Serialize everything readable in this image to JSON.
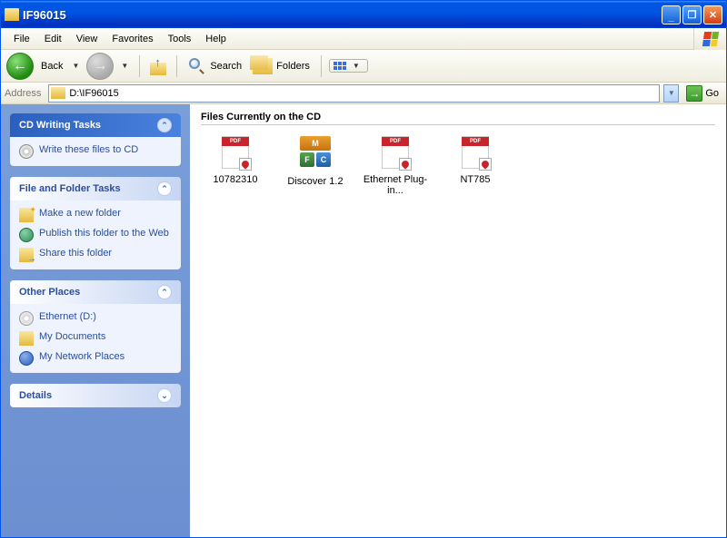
{
  "titlebar": {
    "title": "IF96015"
  },
  "menubar": {
    "items": [
      "File",
      "Edit",
      "View",
      "Favorites",
      "Tools",
      "Help"
    ]
  },
  "toolbar": {
    "back": "Back",
    "search": "Search",
    "folders": "Folders"
  },
  "addressbar": {
    "label": "Address",
    "path": "D:\\IF96015",
    "go": "Go"
  },
  "sidebar": {
    "cd_tasks": {
      "title": "CD Writing Tasks",
      "items": [
        "Write these files to CD"
      ]
    },
    "file_tasks": {
      "title": "File and Folder Tasks",
      "items": [
        "Make a new folder",
        "Publish this folder to the Web",
        "Share this folder"
      ]
    },
    "other_places": {
      "title": "Other Places",
      "items": [
        "Ethernet (D:)",
        "My Documents",
        "My Network Places"
      ]
    },
    "details": {
      "title": "Details"
    }
  },
  "main": {
    "section_title": "Files Currently on the CD",
    "files": [
      {
        "name": "10782310",
        "type": "pdf"
      },
      {
        "name": "Discover 1.2",
        "type": "app"
      },
      {
        "name": "Ethernet Plug-in...",
        "type": "pdf"
      },
      {
        "name": "NT785",
        "type": "pdf"
      }
    ]
  }
}
